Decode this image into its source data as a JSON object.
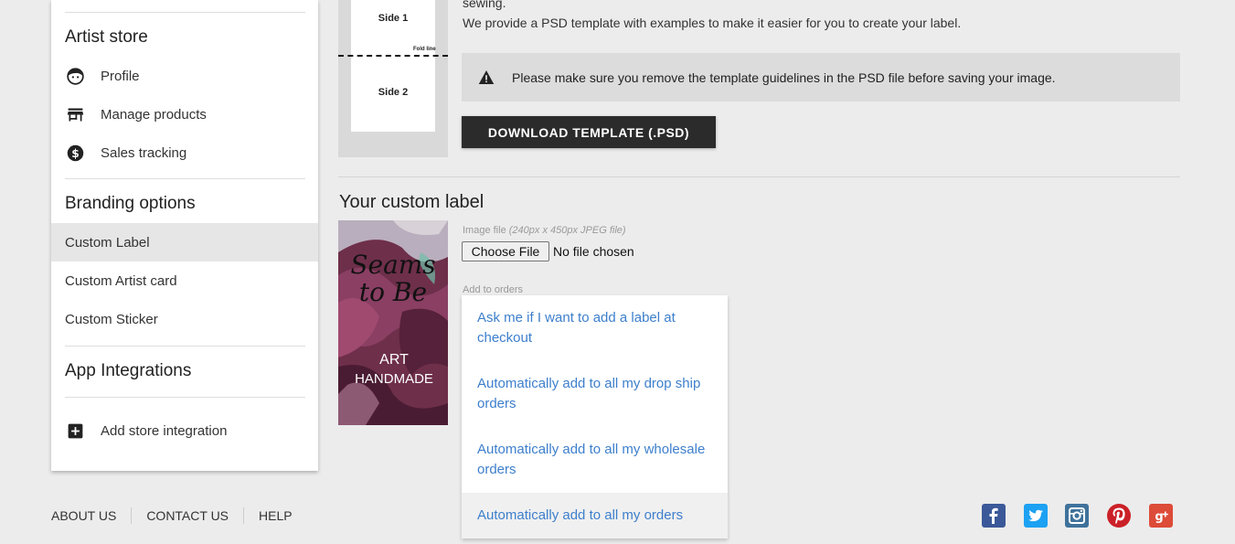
{
  "sidebar": {
    "artist_store": {
      "heading": "Artist store",
      "items": [
        {
          "label": "Profile",
          "icon": "face-icon"
        },
        {
          "label": "Manage products",
          "icon": "store-icon"
        },
        {
          "label": "Sales tracking",
          "icon": "dollar-icon"
        }
      ]
    },
    "branding": {
      "heading": "Branding options",
      "items": [
        {
          "label": "Custom Label",
          "active": true
        },
        {
          "label": "Custom Artist card"
        },
        {
          "label": "Custom Sticker"
        }
      ]
    },
    "integrations": {
      "heading": "App Integrations",
      "items": [
        {
          "label": "Add store integration",
          "icon": "add-box-icon"
        }
      ]
    }
  },
  "template": {
    "side1": "Side 1",
    "side2": "Side 2",
    "fold_line": "Fold line"
  },
  "info": {
    "line1": "sewing.",
    "line2": "We provide a PSD template with examples to make it easier for you to create your label."
  },
  "warning": {
    "icon": "warning-icon",
    "text": "Please make sure you remove the template guidelines in the PSD file before saving your image."
  },
  "download_button": "DOWNLOAD TEMPLATE (.PSD)",
  "custom_label": {
    "title": "Your custom label",
    "image_label": "Image file",
    "image_hint": "(240px x 450px JPEG file)",
    "choose_file": "Choose File",
    "file_status": "No file chosen",
    "add_to_orders_label": "Add to orders",
    "preview": {
      "line1": "Seams",
      "line2": "to Be",
      "line3": "ART",
      "line4": "HANDMADE"
    },
    "options": [
      "Ask me if I want to add a label at checkout",
      "Automatically add to all my drop ship orders",
      "Automatically add to all my wholesale orders",
      "Automatically add to all my orders"
    ]
  },
  "footer": {
    "links": [
      "ABOUT US",
      "CONTACT US",
      "HELP"
    ],
    "social": [
      {
        "name": "facebook-icon",
        "color": "#3b5998"
      },
      {
        "name": "twitter-icon",
        "color": "#1da1f2"
      },
      {
        "name": "instagram-icon",
        "color": "#3f729b"
      },
      {
        "name": "pinterest-icon",
        "color": "#cb2027"
      },
      {
        "name": "google-plus-icon",
        "color": "#dd4b39"
      }
    ]
  }
}
